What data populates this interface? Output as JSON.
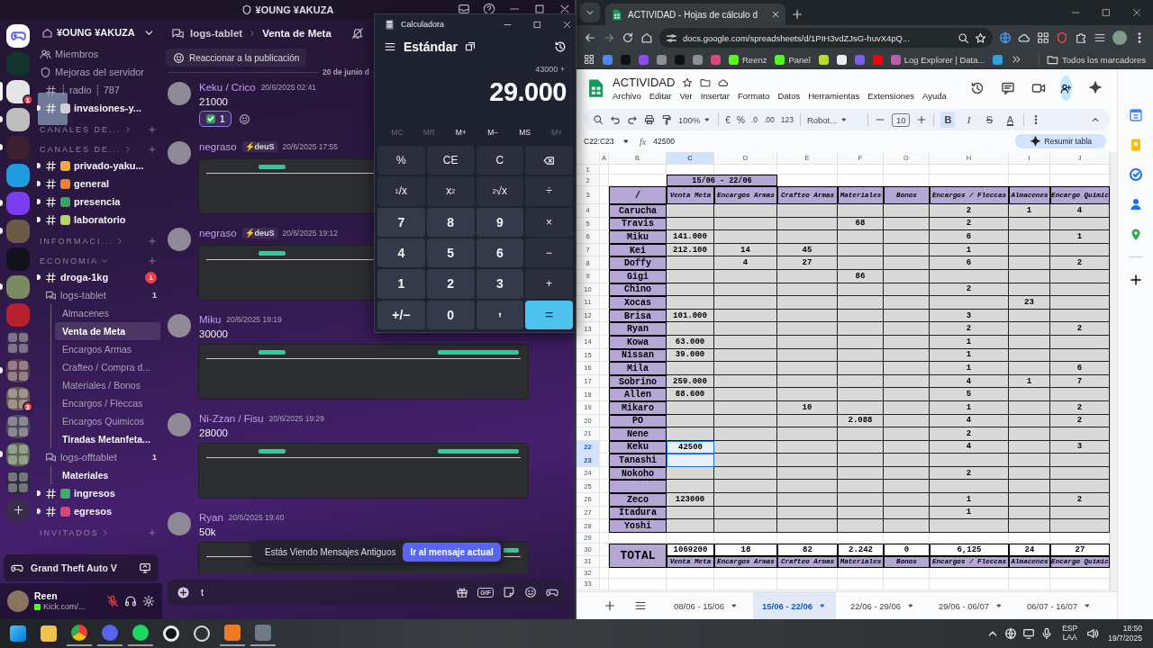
{
  "discord": {
    "title": "¥OUNG ¥AKUZA",
    "server_name": "¥OUNG ¥AKUZA",
    "rail": [
      {
        "kind": "home"
      },
      {
        "kind": "server",
        "color": "#14352e"
      },
      {
        "kind": "server",
        "color": "#e6e6e6",
        "badge": "1",
        "selected": true
      },
      {
        "kind": "server",
        "color": "#bdbdbd",
        "unread": true
      },
      {
        "kind": "server",
        "color": "#3a2030",
        "unread": true
      },
      {
        "kind": "server",
        "color": "#1f9be0"
      },
      {
        "kind": "server",
        "color": "#7a3cf0",
        "unread": true
      },
      {
        "kind": "server",
        "color": "#6b5a48",
        "unread": true
      },
      {
        "kind": "server",
        "color": "#101418"
      },
      {
        "kind": "server",
        "color": "#7a8a60",
        "unread": true
      },
      {
        "kind": "server",
        "color": "#b8202e"
      },
      {
        "kind": "folder",
        "color": "#3a2a4a"
      },
      {
        "kind": "folder",
        "color": "#5a3a4a",
        "unread": true
      },
      {
        "kind": "folder",
        "color": "#6a5a50",
        "badge": "3"
      },
      {
        "kind": "folder",
        "color": "#4a4a5a"
      },
      {
        "kind": "folder",
        "color": "#5a6a50",
        "unread": true
      },
      {
        "kind": "folder",
        "color": "#2a2a3a"
      },
      {
        "kind": "add"
      }
    ],
    "channels": [
      {
        "kind": "members",
        "name": "Miembros"
      },
      {
        "kind": "boosts",
        "name": "Mejoras del servidor"
      },
      {
        "kind": "text",
        "name": "┊ radio ┊ 787",
        "unread": false
      },
      {
        "kind": "text",
        "name": "invasiones-y...",
        "color": "#d0d0d0",
        "unread": true
      },
      {
        "kind": "category",
        "name": "CANALES DE...",
        "expanded": false
      },
      {
        "kind": "category",
        "name": "CANALES DE...",
        "expanded": false
      },
      {
        "kind": "text",
        "name": "privado-yaku...",
        "color": "#f4a640",
        "unread": true
      },
      {
        "kind": "text",
        "name": "general",
        "color": "#f08030",
        "unread": true
      },
      {
        "kind": "text",
        "name": "presencia",
        "color": "#3ba55d",
        "unread": true
      },
      {
        "kind": "text",
        "name": "laboratorio",
        "color": "#b8d860",
        "unread": true
      },
      {
        "kind": "category",
        "name": "INFORMACI...",
        "expanded": false
      },
      {
        "kind": "category",
        "name": "ECONOMIA",
        "expanded": true
      },
      {
        "kind": "text",
        "name": "droga-1kg",
        "badge": "1",
        "unread": true
      },
      {
        "kind": "forum",
        "name": "logs-tablet",
        "count": "1",
        "children": [
          {
            "name": "Almacenes",
            "selected": false,
            "unread": false
          },
          {
            "name": "Venta de Meta",
            "selected": true,
            "unread": false
          },
          {
            "name": "Encargos Armas",
            "selected": false,
            "unread": false
          },
          {
            "name": "Crafteo / Compra d...",
            "selected": false,
            "unread": false
          },
          {
            "name": "Materiales / Bonos",
            "selected": false,
            "unread": false
          },
          {
            "name": "Encargos / Fleccas",
            "selected": false,
            "unread": false
          },
          {
            "name": "Encargos Quimicos",
            "selected": false,
            "unread": false
          },
          {
            "name": "Tiradas Metanfeta...",
            "selected": false,
            "unread": true
          }
        ]
      },
      {
        "kind": "forum",
        "name": "logs-offtablet",
        "count": "1",
        "children": [
          {
            "name": "Materiales",
            "selected": false,
            "unread": true
          }
        ]
      },
      {
        "kind": "text",
        "name": "ingresos",
        "color": "#3bb060",
        "unread": true
      },
      {
        "kind": "text",
        "name": "egresos",
        "color": "#e0457a",
        "unread": true
      },
      {
        "kind": "category",
        "name": "INVITADOS",
        "expanded": false
      }
    ],
    "game": "Grand Theft Auto V",
    "user": {
      "name": "Reen",
      "status": "Kick.com/...",
      "mic_muted": true
    },
    "breadcrumb": {
      "parent": "logs-tablet",
      "current": "Venta de Meta"
    },
    "react_button": "Reaccionar a la publicación",
    "date_divider": "20 de junio d",
    "messages": [
      {
        "author": "Keku / Crico",
        "time": "20/6/2025 02:41",
        "text": "21000",
        "reactions": [
          {
            "count": "1",
            "selected": true
          }
        ]
      },
      {
        "author": "negraso",
        "tag": "⚡deuS",
        "time": "20/6/2025 17:55",
        "image": true
      },
      {
        "author": "negraso",
        "tag": "⚡deuS",
        "time": "20/6/2025 19:12",
        "image": true
      },
      {
        "author": "Miku",
        "time": "20/6/2025 19:19",
        "text": "30000",
        "image": true
      },
      {
        "author": "Ni-Zzan / Fisu",
        "time": "20/6/2025 19:29",
        "text": "28000",
        "image": true
      },
      {
        "author": "Ryan",
        "time": "20/6/2025 19:40",
        "text": "50k",
        "image": true
      }
    ],
    "banner": {
      "text": "Estás Viendo Mensajes Antiguos",
      "button": "Ir al mensaje actual"
    },
    "composer": {
      "value": "t",
      "gif": "GIF"
    }
  },
  "calculator": {
    "title": "Calculadora",
    "mode": "Estándar",
    "expression": "43000 +",
    "display": "29.000",
    "memory": [
      {
        "label": "MC",
        "disabled": true
      },
      {
        "label": "MR",
        "disabled": true
      },
      {
        "label": "M+",
        "disabled": false
      },
      {
        "label": "M−",
        "disabled": false
      },
      {
        "label": "MS",
        "disabled": false
      },
      {
        "label": "M˅",
        "disabled": true
      }
    ],
    "keys": [
      {
        "kind": "fn",
        "label": "%"
      },
      {
        "kind": "fn",
        "label": "CE"
      },
      {
        "kind": "fn",
        "label": "C"
      },
      {
        "kind": "backspace"
      },
      {
        "kind": "fn",
        "label": "$^{1}$/x"
      },
      {
        "kind": "fn",
        "label": "x$^{2}$"
      },
      {
        "kind": "fn",
        "label": "$^{2}$√x"
      },
      {
        "kind": "fn",
        "label": "÷"
      },
      {
        "kind": "num",
        "label": "7"
      },
      {
        "kind": "num",
        "label": "8"
      },
      {
        "kind": "num",
        "label": "9"
      },
      {
        "kind": "fn",
        "label": "×"
      },
      {
        "kind": "num",
        "label": "4"
      },
      {
        "kind": "num",
        "label": "5"
      },
      {
        "kind": "num",
        "label": "6"
      },
      {
        "kind": "fn",
        "label": "−"
      },
      {
        "kind": "num",
        "label": "1"
      },
      {
        "kind": "num",
        "label": "2"
      },
      {
        "kind": "num",
        "label": "3"
      },
      {
        "kind": "fn",
        "label": "+"
      },
      {
        "kind": "num",
        "label": "+/−"
      },
      {
        "kind": "num",
        "label": "0"
      },
      {
        "kind": "decimal",
        "label": ","
      },
      {
        "kind": "equals",
        "label": "="
      }
    ]
  },
  "browser": {
    "tab_title": "ACTIVIDAD - Hojas de cálculo d",
    "url": "docs.google.com/spreadsheets/d/1PIH3vdZJsG-huvX4pQ...",
    "bookmarks": [
      {
        "color": "#4a8af4"
      },
      {
        "color": "#111111"
      },
      {
        "color": "#9146ff"
      },
      {
        "color": "#8a8f98"
      },
      {
        "color": "#111111"
      },
      {
        "color": "#8a8f98"
      },
      {
        "color": "#e0457a"
      },
      {
        "color": "#53fc18",
        "label": "Reenz"
      },
      {
        "color": "#53fc18",
        "label": "Panel"
      },
      {
        "color": "#b8e020"
      },
      {
        "color": "#eeeeee"
      },
      {
        "color": "#7b5cf0"
      },
      {
        "color": "#ff0000"
      },
      {
        "color": "#c05ab0",
        "label": "Log Explorer | Data..."
      },
      {
        "color": "#2aa3e0"
      }
    ],
    "all_bookmarks": "Todos los marcadores"
  },
  "sheet": {
    "title": "ACTIVIDAD",
    "menu": [
      "Archivo",
      "Editar",
      "Ver",
      "Insertar",
      "Formato",
      "Datos",
      "Herramientas",
      "Extensiones",
      "Ayuda"
    ],
    "toolbar": {
      "zoom": "100%",
      "currency": "€",
      "percent": "%",
      "dec_decimals": ".0",
      "inc_decimals": ".00",
      "number_format": "123",
      "font": "Robot...",
      "font_size": "10",
      "format_buttons": [
        {
          "kind": "bold",
          "label": "B",
          "active": true
        },
        {
          "kind": "italic",
          "label": "I",
          "active": false
        },
        {
          "kind": "strike",
          "label": "S",
          "active": false
        },
        {
          "kind": "color",
          "label": "A",
          "active": false
        }
      ]
    },
    "name_box": "C22:C23",
    "fx": "fx",
    "formula": "42500",
    "summarize_button": "Resumir tabla",
    "columns": [
      {
        "label": "A",
        "selected": false
      },
      {
        "label": "B",
        "selected": false
      },
      {
        "label": "C",
        "selected": true
      },
      {
        "label": "D",
        "selected": false
      },
      {
        "label": "E",
        "selected": false
      },
      {
        "label": "F",
        "selected": false
      },
      {
        "label": "G",
        "selected": false
      },
      {
        "label": "H",
        "selected": false
      },
      {
        "label": "I",
        "selected": false
      },
      {
        "label": "J",
        "selected": false
      }
    ],
    "row_numbers": [
      {
        "label": "1",
        "selected": false
      },
      {
        "label": "2",
        "selected": false
      },
      {
        "label": "3",
        "selected": false
      },
      {
        "label": "4",
        "selected": false
      },
      {
        "label": "5",
        "selected": false
      },
      {
        "label": "6",
        "selected": false
      },
      {
        "label": "7",
        "selected": false
      },
      {
        "label": "8",
        "selected": false
      },
      {
        "label": "9",
        "selected": false
      },
      {
        "label": "10",
        "selected": false
      },
      {
        "label": "11",
        "selected": false
      },
      {
        "label": "12",
        "selected": false
      },
      {
        "label": "13",
        "selected": false
      },
      {
        "label": "14",
        "selected": false
      },
      {
        "label": "15",
        "selected": false
      },
      {
        "label": "16",
        "selected": false
      },
      {
        "label": "17",
        "selected": false
      },
      {
        "label": "18",
        "selected": false
      },
      {
        "label": "19",
        "selected": false
      },
      {
        "label": "20",
        "selected": false
      },
      {
        "label": "21",
        "selected": false
      },
      {
        "label": "22",
        "selected": true
      },
      {
        "label": "23",
        "selected": true
      },
      {
        "label": "24",
        "selected": false
      },
      {
        "label": "25",
        "selected": false
      },
      {
        "label": "26",
        "selected": false
      },
      {
        "label": "27",
        "selected": false
      },
      {
        "label": "28",
        "selected": false
      },
      {
        "label": "29",
        "selected": false
      },
      {
        "label": "30",
        "selected": false
      },
      {
        "label": "31",
        "selected": false
      },
      {
        "label": "32",
        "selected": false
      },
      {
        "label": "33",
        "selected": false
      }
    ],
    "period": "15/06 - 22/06",
    "corner": "/",
    "headers": [
      "Venta Meta",
      "Encargos Armas",
      "Crafteo Armas",
      "Materiales",
      "Bonos",
      "Encargos / Fleccas",
      "Almacenes",
      "Encargo Quimic"
    ],
    "rows": [
      {
        "name": "Carucha",
        "cells": {
          "encargos_fleccas": "2",
          "almacenes": "1",
          "encargo_quimic": "4"
        }
      },
      {
        "name": "Travis",
        "cells": {
          "materiales": "68",
          "encargos_fleccas": "2"
        }
      },
      {
        "name": "Miku",
        "cells": {
          "venta_meta": "141.000",
          "encargos_fleccas": "6",
          "encargo_quimic": "1"
        }
      },
      {
        "name": "Kei",
        "cells": {
          "venta_meta": "212.100",
          "encargos_armas": "14",
          "crafteo_armas": "45",
          "encargos_fleccas": "1"
        }
      },
      {
        "name": "Doffy",
        "cells": {
          "encargos_armas": "4",
          "crafteo_armas": "27",
          "encargos_fleccas": "6",
          "encargo_quimic": "2"
        }
      },
      {
        "name": "Gigi",
        "cells": {
          "materiales": "86"
        }
      },
      {
        "name": "Chino",
        "cells": {
          "encargos_fleccas": "2"
        }
      },
      {
        "name": "Xocas",
        "cells": {
          "almacenes": "23"
        }
      },
      {
        "name": "Brisa",
        "cells": {
          "venta_meta": "101.000",
          "encargos_fleccas": "3"
        }
      },
      {
        "name": "Ryan",
        "cells": {
          "encargos_fleccas": "2",
          "encargo_quimic": "2"
        }
      },
      {
        "name": "Kowa",
        "cells": {
          "venta_meta": "63.000",
          "encargos_fleccas": "1"
        }
      },
      {
        "name": "Nissan",
        "cells": {
          "venta_meta": "39.000",
          "encargos_fleccas": "1"
        }
      },
      {
        "name": "Mila",
        "cells": {
          "encargos_fleccas": "1",
          "encargo_quimic": "6"
        }
      },
      {
        "name": "Sobrino",
        "cells": {
          "venta_meta": "259.000",
          "encargos_fleccas": "4",
          "almacenes": "1",
          "encargo_quimic": "7"
        }
      },
      {
        "name": "Allen",
        "cells": {
          "venta_meta": "88.600",
          "encargos_fleccas": "5"
        }
      },
      {
        "name": "Mikaro",
        "cells": {
          "crafteo_armas": "10",
          "encargos_fleccas": "1",
          "encargo_quimic": "2"
        }
      },
      {
        "name": "PO",
        "cells": {
          "materiales": "2.088",
          "encargos_fleccas": "4",
          "encargo_quimic": "2"
        }
      },
      {
        "name": "Nene",
        "cells": {
          "encargos_fleccas": "2"
        }
      },
      {
        "name": "Keku",
        "cells": {
          "venta_meta": "42500",
          "encargos_fleccas": "4",
          "encargo_quimic": "3"
        }
      },
      {
        "name": "Tanashi"
      },
      {
        "name": "Nokoho",
        "cells": {
          "encargos_fleccas": "2"
        }
      },
      {},
      {
        "name": "Zeco",
        "cells": {
          "venta_meta": "123000",
          "encargos_fleccas": "1",
          "encargo_quimic": "2"
        }
      },
      {
        "name": "Itadura",
        "cells": {
          "encargos_fleccas": "1"
        }
      },
      {
        "name": "Yoshi"
      }
    ],
    "total": {
      "label": "TOTAL",
      "values": [
        "1069200",
        "18",
        "82",
        "2.242",
        "0",
        "6,125",
        "24",
        "27"
      ]
    },
    "footer_headers": [
      "Venta Meta",
      "Encargos Armas",
      "Crafteo Armas",
      "Materiales",
      "Bonos",
      "Encargos / Fleccas",
      "Almacenes",
      "Encargo Quimic"
    ],
    "tabs": [
      {
        "label": "08/06 - 15/06",
        "selected": false
      },
      {
        "label": "15/06 - 22/06",
        "selected": true
      },
      {
        "label": "22/06 - 29/06",
        "selected": false
      },
      {
        "label": "29/06 - 06/07",
        "selected": false
      },
      {
        "label": "06/07 - 16/07",
        "selected": false
      }
    ]
  },
  "taskbar": {
    "apps": [
      {
        "kind": "start",
        "running": false
      },
      {
        "kind": "explorer",
        "running": false
      },
      {
        "kind": "chrome",
        "running": true
      },
      {
        "kind": "discord",
        "running": true
      },
      {
        "kind": "spotify",
        "running": true
      },
      {
        "kind": "circle",
        "running": false
      },
      {
        "kind": "obs",
        "running": false
      },
      {
        "kind": "orange",
        "running": true
      },
      {
        "kind": "calculator",
        "running": true
      }
    ],
    "lang": "ESP",
    "layout": "LAA",
    "time": "18:50",
    "date": "19/7/2025"
  }
}
